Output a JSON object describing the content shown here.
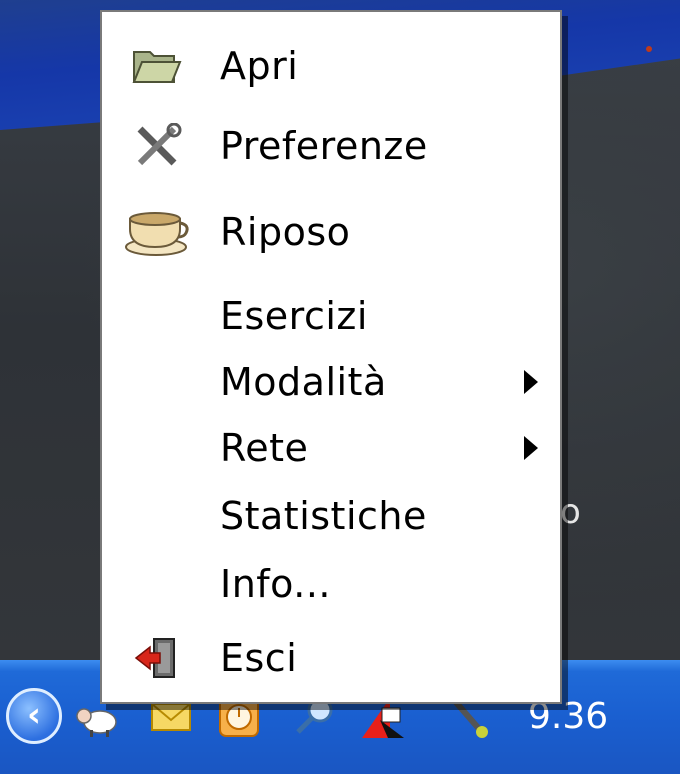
{
  "menu": {
    "items": [
      {
        "label": "Apri",
        "icon": "folder-icon",
        "submenu": false
      },
      {
        "label": "Preferenze",
        "icon": "tools-icon",
        "submenu": false
      },
      {
        "label": "Riposo",
        "icon": "coffee-cup-icon",
        "submenu": false
      },
      {
        "label": "Esercizi",
        "icon": "",
        "submenu": false
      },
      {
        "label": "Modalità",
        "icon": "",
        "submenu": true
      },
      {
        "label": "Rete",
        "icon": "",
        "submenu": true
      },
      {
        "label": "Statistiche",
        "icon": "",
        "submenu": false
      },
      {
        "label": "Info...",
        "icon": "",
        "submenu": false
      },
      {
        "label": "Esci",
        "icon": "exit-door-icon",
        "submenu": false
      }
    ]
  },
  "taskbar": {
    "clock": "9.36",
    "tray_icons": [
      "show-hidden-icons-icon",
      "sheep-icon",
      "mail-icon",
      "app-clock-icon",
      "search-magnifier-icon",
      "network-icon",
      "pen-icon"
    ]
  },
  "desktop": {
    "partial_text": "o"
  },
  "colors": {
    "taskbar": "#1a5fd0",
    "menu_background": "#ffffff",
    "menu_border": "#7a7a7a"
  }
}
